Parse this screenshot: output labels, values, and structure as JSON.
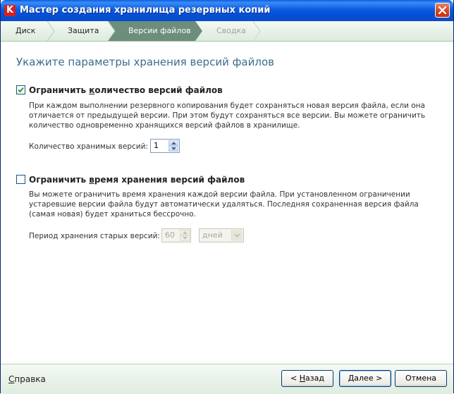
{
  "window": {
    "title": "Мастер создания хранилища резервных копий",
    "app_icon": "kaspersky-k-icon",
    "close_icon": "close-icon"
  },
  "steps": [
    {
      "label": "Диск",
      "state": "done"
    },
    {
      "label": "Защита",
      "state": "done"
    },
    {
      "label": "Версии файлов",
      "state": "active"
    },
    {
      "label": "Сводка",
      "state": "disabled"
    }
  ],
  "colors": {
    "title_bar": "#0a5ce0",
    "active_step": "#6d8d7d",
    "heading": "#3a6d8c",
    "panel_bg": "#e6f0e6"
  },
  "content": {
    "heading": "Укажите параметры хранения версий файлов",
    "option1": {
      "checked": true,
      "title_prefix": "Ограничить ",
      "title_access": "к",
      "title_suffix": "оличество версий файлов",
      "description": "При каждом выполнении резервного копирования будет сохраняться новая версия файла, если она отличается от предыдущей версии. При этом будут сохраняться все версии. Вы можете ограничить количество одновременно хранящихся версий файлов в хранилище.",
      "field_label": "Количество хранимых версий:",
      "value": "1"
    },
    "option2": {
      "checked": false,
      "title_prefix": "Ограничить ",
      "title_access": "в",
      "title_suffix": "ремя хранения версий файлов",
      "description": "Вы можете ограничить время хранения каждой версии файла. При установленном ограничении устаревшие версии файла будут автоматически удаляться. Последняя сохраненная версия файла (самая новая) будет храниться бессрочно.",
      "field_label": "Период хранения старых версий:",
      "value": "60",
      "unit": "дней"
    }
  },
  "footer": {
    "help_access": "С",
    "help_rest": "правка",
    "back_prefix": "< ",
    "back_access": "Н",
    "back_rest": "азад",
    "next_access": "Д",
    "next_rest": "алее >",
    "cancel": "Отмена"
  }
}
